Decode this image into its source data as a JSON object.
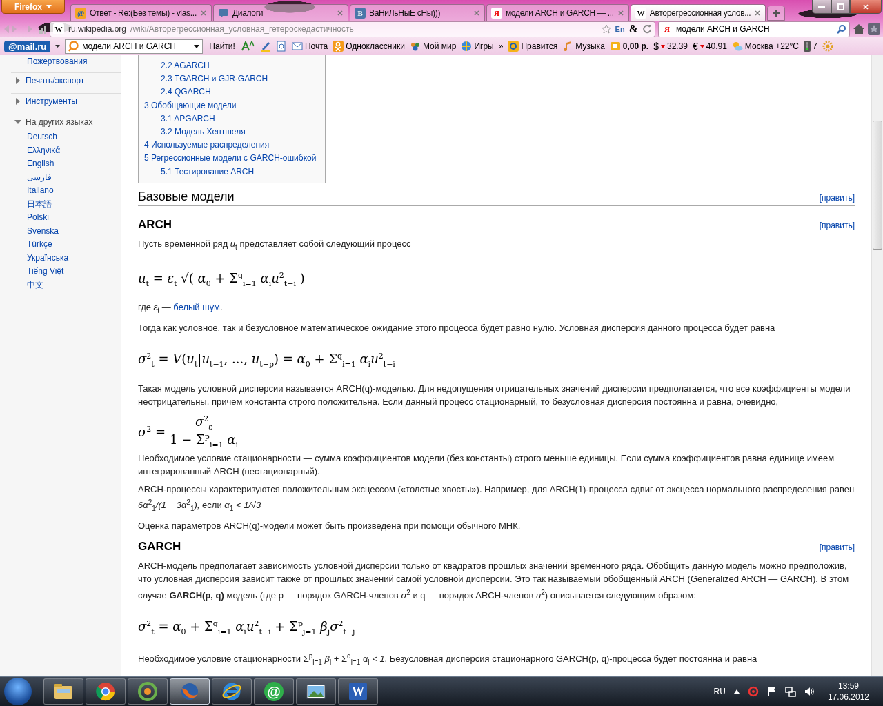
{
  "browser": {
    "menu_button": "Firefox",
    "tabs": [
      {
        "title": "Ответ - Re:(Без темы) - vlas...",
        "selected": false,
        "icon": {
          "kind": "mail",
          "text": "@"
        }
      },
      {
        "title": "Диалоги",
        "selected": false,
        "icon": {
          "kind": "chat"
        }
      },
      {
        "title": "ВаНиЛьНыЕ сНы)))",
        "selected": false,
        "icon": {
          "kind": "vk",
          "text": "B"
        }
      },
      {
        "title": "модели ARCH и GARCH — ...",
        "selected": false,
        "icon": {
          "kind": "yandex",
          "text": "Я"
        }
      },
      {
        "title": "Авторегрессионная услов...",
        "selected": true,
        "icon": {
          "kind": "wiki",
          "text": "W"
        }
      }
    ],
    "address": {
      "favicon": "W",
      "host": "ru.wikipedia.org",
      "path": "/wiki/Авторегрессионная_условная_гетероскедастичность",
      "ime": "En",
      "amp": "&"
    },
    "search": {
      "engine": "Я",
      "value": "модели ARCH и GARCH"
    }
  },
  "mail_toolbar": {
    "logo": "@mail.ru",
    "search_value": "модели ARCH и GARCH",
    "find_button": "Найти!",
    "items": [
      {
        "kind": "mail",
        "label": "Почта"
      },
      {
        "kind": "ok",
        "label": "Одноклассники"
      },
      {
        "kind": "world",
        "label": "Мой мир"
      },
      {
        "kind": "games",
        "label": "Игры"
      },
      {
        "kind": "more",
        "label": "»"
      },
      {
        "kind": "like",
        "label": "Нравится"
      },
      {
        "kind": "music",
        "label": "Музыка"
      },
      {
        "kind": "wallet",
        "label": "0,00 р."
      },
      {
        "kind": "currency",
        "symbol": "$",
        "label": "32.39"
      },
      {
        "kind": "currency",
        "symbol": "€",
        "label": "40.91"
      },
      {
        "kind": "weather",
        "label": "Москва +22°C"
      },
      {
        "kind": "traffic",
        "label": "7"
      }
    ]
  },
  "sidebar": {
    "top_link": "Пожертвования",
    "sections": [
      {
        "label": "Печать/экспорт",
        "expanded": false
      },
      {
        "label": "Инструменты",
        "expanded": false
      },
      {
        "label": "На других языках",
        "expanded": true,
        "items": [
          "Deutsch",
          "Ελληνικά",
          "English",
          "فارسی",
          "Italiano",
          "日本語",
          "Polski",
          "Svenska",
          "Türkçe",
          "Українська",
          "Tiếng Việt",
          "中文"
        ]
      }
    ]
  },
  "toc": [
    {
      "children": [
        {
          "label": "2.2 AGARCH"
        },
        {
          "label": "2.3 TGARCH и GJR-GARCH"
        },
        {
          "label": "2.4 QGARCH"
        }
      ]
    },
    {
      "label": "3 Обобщающие модели",
      "children": [
        {
          "label": "3.1 APGARCH"
        },
        {
          "label": "3.2 Модель Хентшеля"
        }
      ]
    },
    {
      "label": "4 Используемые распределения"
    },
    {
      "label": "5 Регрессионные модели с GARCH-ошибкой",
      "children": [
        {
          "label": "5.1 Тестирование ARCH"
        }
      ]
    }
  ],
  "article": [
    {
      "kind": "h2",
      "text": "Базовые модели",
      "edit": "[править]"
    },
    {
      "kind": "h3",
      "text": "ARCH",
      "edit": "[править]"
    },
    {
      "kind": "p",
      "text": "Пусть временной ряд *u*$_{t}$ представляет собой следующий процесс"
    },
    {
      "kind": "formula",
      "text": "*u*$_{t}$ = *ε*$_{t}$ √( *α*$_{0}$ + Σ$^{q}$$_{i=1}$ *α*$_{i}$*u*$^{2}$$_{t−i}$ )"
    },
    {
      "kind": "p",
      "text": "где *ε*$_{t}$ —",
      "link": "белый шум",
      "tail": "."
    },
    {
      "kind": "p",
      "text": "Тогда как условное, так и безусловное математическое ожидание этого процесса будет равно нулю. Условная дисперсия данного процесса будет равна"
    },
    {
      "kind": "formula",
      "text": "*σ*$^{2}$$_{t}$ = *V*(*u*$_{t}$|*u*$_{t−1}$, ..., *u*$_{t−p}$) = *α*$_{0}$ + Σ$^{q}$$_{i=1}$ *α*$_{i}$*u*$^{2}$$_{t−i}$"
    },
    {
      "kind": "p",
      "text": "Такая модель условной дисперсии называется ARCH(q)-моделью. Для недопущения отрицательных значений дисперсии предполагается, что все коэффициенты модели неотрицательны, причем константа строго положительна. Если данный процесс стационарный, то безусловная дисперсия постоянна и равна, очевидно,"
    },
    {
      "kind": "fraction",
      "lhs": "*σ*$^{2}$ =",
      "numerator": "*σ*$^{2}$$_{ε}$",
      "denominator": "1 − Σ$^{p}$$_{i=1}$ *α*$_{i}$"
    },
    {
      "kind": "p",
      "text": "Необходимое условие стационарности — сумма коэффициентов модели (без константы) строго меньше единицы. Если сумма коэффициентов равна единице имеем интегрированный ARCH (нестационарный)."
    },
    {
      "kind": "p",
      "text": "ARCH-процессы характеризуются положительным эксцессом («толстые хвосты»). Например, для ARCH(1)-процесса сдвиг от эксцесса нормального распределения равен *6α*$^{2}$$_{1}$*/(1 − 3α*$^{2}$$_{1}$*),* если *α*$_{1}$ *< 1/√3*"
    },
    {
      "kind": "p",
      "text": "Оценка параметров ARCH(q)-модели может быть произведена при помощи обычного МНК."
    },
    {
      "kind": "h3",
      "text": "GARCH",
      "edit": "[править]"
    },
    {
      "kind": "p",
      "text": "ARCH-модель предполагает зависимость условной дисперсии только от квадратов прошлых значений временного ряда. Обобщить данную модель можно предположив, что условная дисперсия зависит также от прошлых значений самой условной дисперсии. Это так называемый обобщенный ARCH (Generalized ARCH — GARCH). В этом случае **GARCH(p, q)** модель (где p — порядок GARCH-членов *σ*$^{2}$ и q — порядок ARCH-членов *u*$^{2}$) описывается следующим образом:"
    },
    {
      "kind": "formula",
      "text": "*σ*$^{2}$$_{t}$ = *α*$_{0}$ + Σ$^{q}$$_{i=1}$ *α*$_{i}$*u*$^{2}$$_{t−i}$ + Σ$^{p}$$_{j=1}$ *β*$_{j}$*σ*$^{2}$$_{t−j}$"
    },
    {
      "kind": "p",
      "text": "Необходимое условие стационарности Σ$^{p}$$_{i=1}$ *β*$_{i}$ + Σ$^{q}$$_{i=1}$ *α*$_{i}$ *< 1*. Безусловная дисперсия стационарного GARCH(p, q)-процесса будет постоянна и равна"
    }
  ],
  "taskbar": {
    "apps": [
      {
        "kind": "folder",
        "selected": false
      },
      {
        "kind": "globe",
        "selected": false
      },
      {
        "kind": "flower",
        "selected": false
      },
      {
        "kind": "fox",
        "selected": true
      },
      {
        "kind": "ie",
        "selected": false
      },
      {
        "kind": "agent",
        "selected": false,
        "text": "@"
      },
      {
        "kind": "photo",
        "selected": false
      },
      {
        "kind": "word",
        "selected": false,
        "text": "W"
      }
    ],
    "lang": "RU",
    "time": "13:59",
    "date": "17.06.2012"
  }
}
